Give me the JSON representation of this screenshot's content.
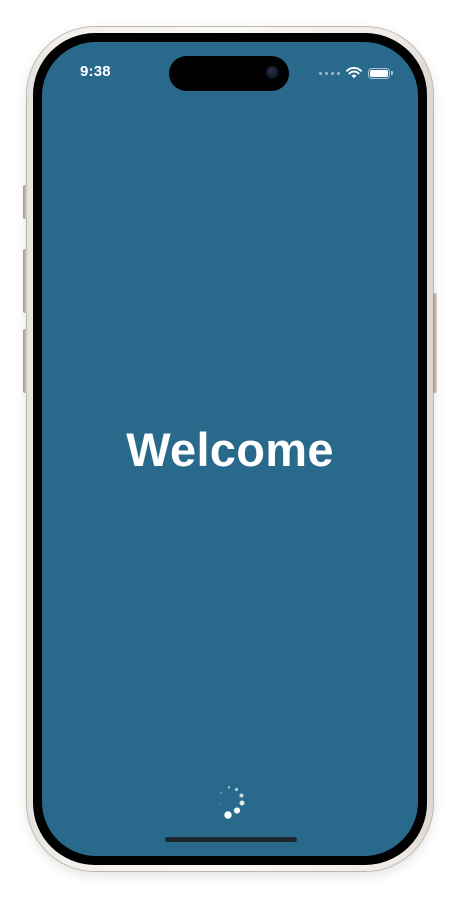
{
  "status_bar": {
    "time": "9:38",
    "icons": [
      "signal-dots-icon",
      "wifi-icon",
      "battery-icon"
    ],
    "battery_level": 1.0
  },
  "screen": {
    "title": "Welcome",
    "background_color": "#296a8c",
    "loading_indicator": "activity-spinner-icon"
  }
}
